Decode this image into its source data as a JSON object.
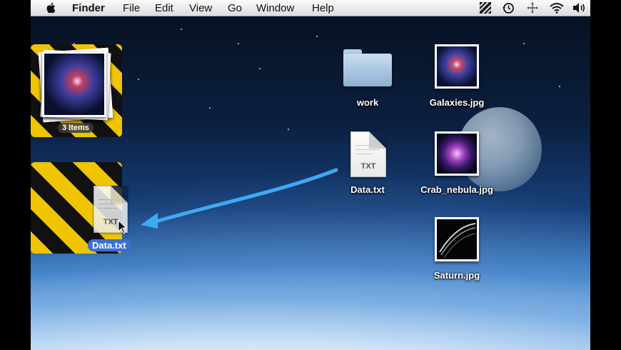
{
  "menubar": {
    "apple_menu": "",
    "app_name": "Finder",
    "items": [
      "File",
      "Edit",
      "View",
      "Go",
      "Window",
      "Help"
    ],
    "status_icons": [
      "diagonal-stripes-icon",
      "time-machine-icon",
      "bluetooth-move-icon",
      "wifi-icon",
      "volume-icon"
    ]
  },
  "desktop": {
    "stack_top": {
      "label": "3 Items"
    },
    "stack_bottom": {
      "dragged_file": "Data.txt",
      "dragged_file_ext": "TXT"
    },
    "icons": [
      {
        "label": "work",
        "type": "folder"
      },
      {
        "label": "Galaxies.jpg",
        "type": "image"
      },
      {
        "label": "Data.txt",
        "type": "text",
        "ext": "TXT"
      },
      {
        "label": "Crab_nebula.jpg",
        "type": "image"
      },
      {
        "label": "Saturn.jpg",
        "type": "image"
      }
    ]
  },
  "colors": {
    "stripe_yellow": "#f0c400",
    "stripe_black": "#111111",
    "arrow_blue": "#3fa9f5",
    "selection_blue": "#3c6fd1"
  }
}
